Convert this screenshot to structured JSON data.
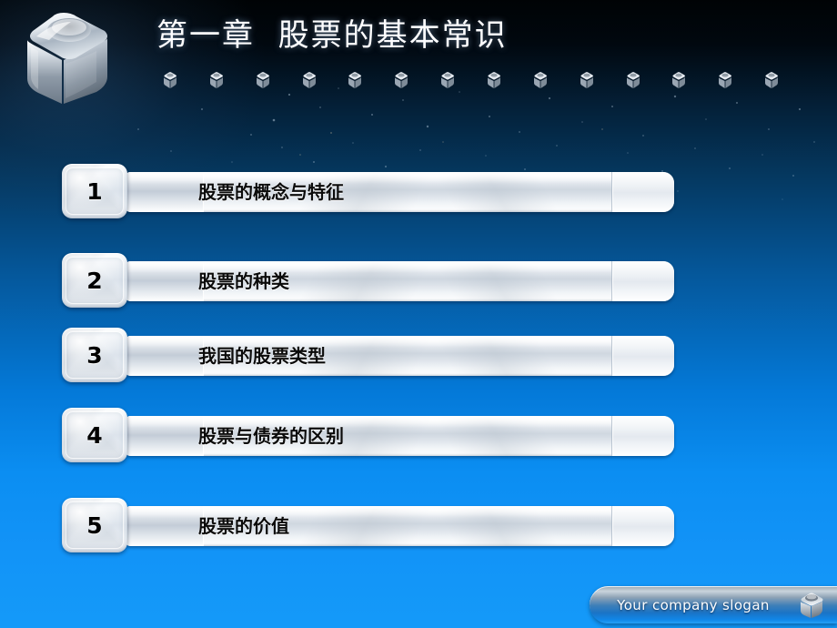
{
  "slide": {
    "title": "第一章  股票的基本常识",
    "logo_icon": "chrome-cube-icon",
    "decor_cube_icon": "mini-cube-icon",
    "decor_cube_count": 14,
    "colors": {
      "background_top": "#000305",
      "background_mid": "#05579a",
      "background_bottom": "#149af9",
      "bar_light": "#ffffff",
      "bar_shade": "#cfd7e0",
      "label_text": "#0b0b0b",
      "title_text": "#fdfdff",
      "footer_text": "#ffffff"
    }
  },
  "agenda": {
    "items": [
      {
        "number": "1",
        "label": "股票的概念与特征"
      },
      {
        "number": "2",
        "label": "股票的种类"
      },
      {
        "number": "3",
        "label": "我国的股票类型"
      },
      {
        "number": "4",
        "label": "股票与债券的区别"
      },
      {
        "number": "5",
        "label": "股票的价值"
      }
    ]
  },
  "footer": {
    "slogan": "Your company slogan",
    "cube_icon": "chrome-cube-icon"
  }
}
